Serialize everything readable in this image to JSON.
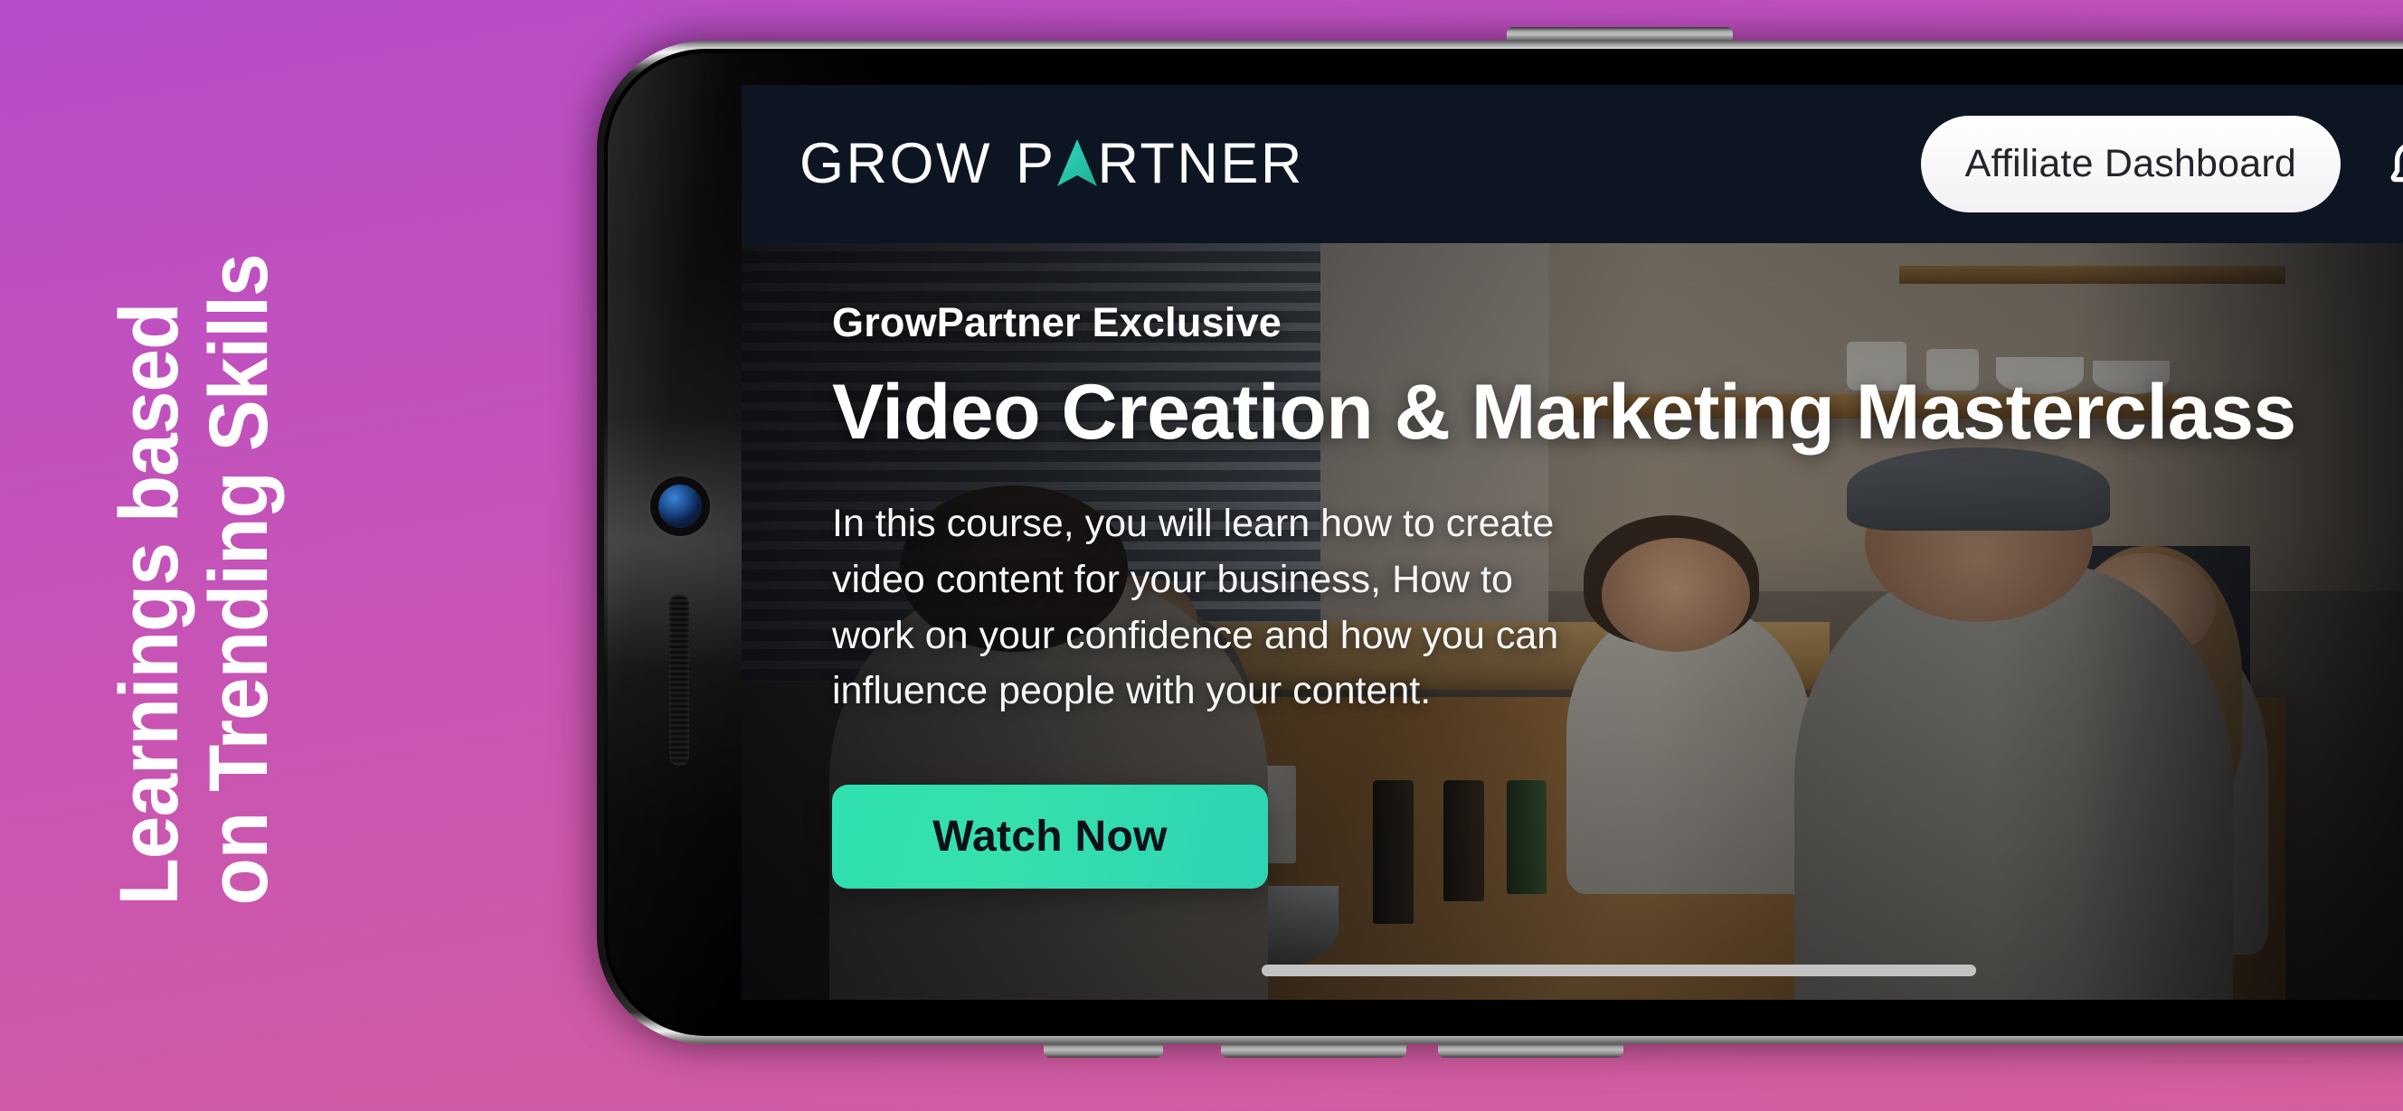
{
  "banner": {
    "promo_lines": [
      "Learnings based",
      "on Trending Skills"
    ],
    "bg_gradient_top": "#b54cc8",
    "bg_gradient_bottom": "#d65e9c"
  },
  "app": {
    "appbar": {
      "logo": {
        "word1": "GROW",
        "word2_pre": "P",
        "word2_post": "RTNER",
        "arrow_icon": "up-arrow-icon",
        "arrow_color": "#2ed3b4"
      },
      "dashboard_button": "Affiliate Dashboard",
      "notification_icon": "bell-icon",
      "bar_color": "#0d1522"
    },
    "hero": {
      "eyebrow": "GrowPartner Exclusive",
      "headline": "Video Creation & Marketing Masterclass",
      "subcopy": "In this course, you will learn how to create video content for your business, How to work on your confidence and how you can influence people with your content.",
      "cta_label": "Watch Now",
      "cta_color": "#2ed3b4",
      "cta_text_color": "#0c1118",
      "photo_description": "group of people seated around a wooden table in a cafe kitchen"
    },
    "home_indicator_color": "#c3c3c3"
  },
  "device": {
    "orientation": "landscape",
    "camera_icon": "front-camera-icon",
    "speaker_icon": "earpiece-speaker-icon",
    "buttons": [
      "power-button",
      "volume-button-1",
      "volume-button-2",
      "volume-button-3"
    ]
  }
}
